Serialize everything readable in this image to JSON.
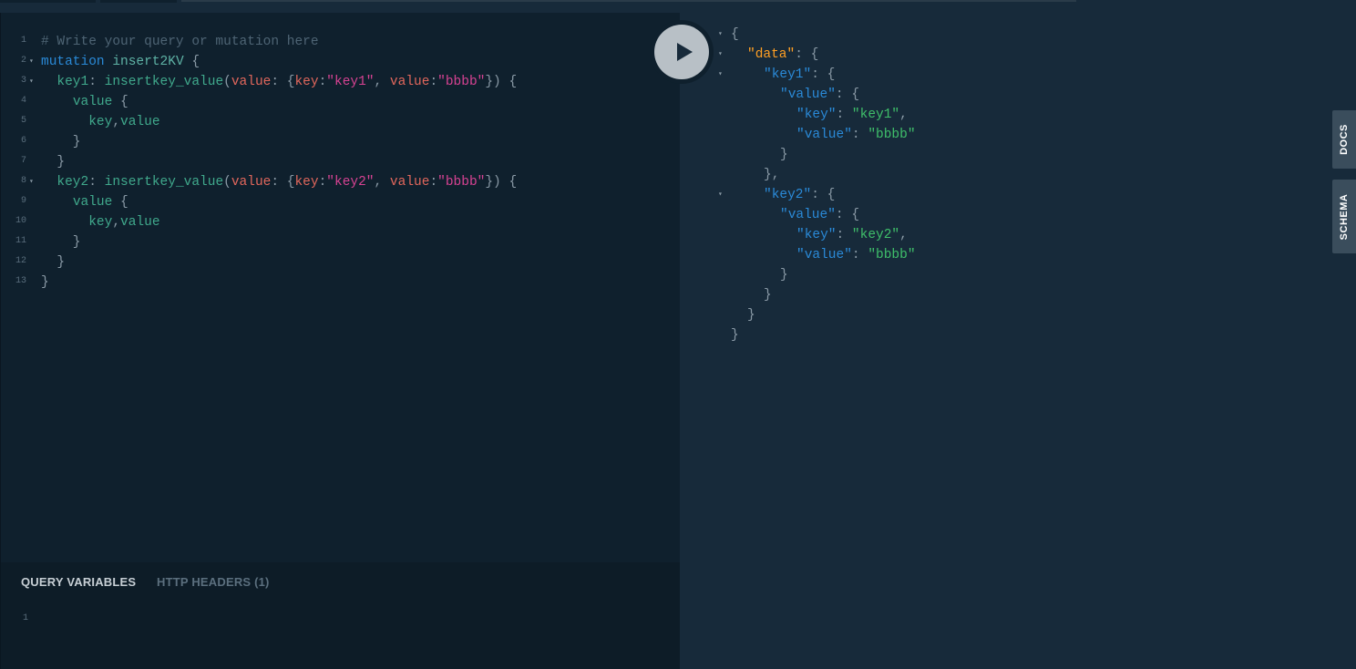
{
  "query_editor": {
    "lines": [
      {
        "n": "1",
        "tokens": [
          {
            "t": "# Write your query or mutation here",
            "c": "comment"
          }
        ]
      },
      {
        "n": "2",
        "fold": true,
        "tokens": [
          {
            "t": "mutation",
            "c": "kw"
          },
          {
            "t": " ",
            "c": "punct"
          },
          {
            "t": "insert2KV",
            "c": "def"
          },
          {
            "t": " {",
            "c": "punct"
          }
        ]
      },
      {
        "n": "3",
        "fold": true,
        "tokens": [
          {
            "t": "  ",
            "c": "punct"
          },
          {
            "t": "key1",
            "c": "field"
          },
          {
            "t": ": ",
            "c": "punct"
          },
          {
            "t": "insertkey_value",
            "c": "field"
          },
          {
            "t": "(",
            "c": "punct"
          },
          {
            "t": "value",
            "c": "arg"
          },
          {
            "t": ": {",
            "c": "punct"
          },
          {
            "t": "key",
            "c": "arg"
          },
          {
            "t": ":",
            "c": "punct"
          },
          {
            "t": "\"key1\"",
            "c": "str"
          },
          {
            "t": ", ",
            "c": "punct"
          },
          {
            "t": "value",
            "c": "arg"
          },
          {
            "t": ":",
            "c": "punct"
          },
          {
            "t": "\"bbbb\"",
            "c": "str"
          },
          {
            "t": "}) {",
            "c": "punct"
          }
        ]
      },
      {
        "n": "4",
        "tokens": [
          {
            "t": "    ",
            "c": "punct"
          },
          {
            "t": "value",
            "c": "field"
          },
          {
            "t": " {",
            "c": "punct"
          }
        ]
      },
      {
        "n": "5",
        "tokens": [
          {
            "t": "      ",
            "c": "punct"
          },
          {
            "t": "key",
            "c": "field"
          },
          {
            "t": ",",
            "c": "punct"
          },
          {
            "t": "value",
            "c": "field"
          }
        ]
      },
      {
        "n": "6",
        "tokens": [
          {
            "t": "    }",
            "c": "punct"
          }
        ]
      },
      {
        "n": "7",
        "tokens": [
          {
            "t": "  }",
            "c": "punct"
          }
        ]
      },
      {
        "n": "8",
        "fold": true,
        "tokens": [
          {
            "t": "  ",
            "c": "punct"
          },
          {
            "t": "key2",
            "c": "field"
          },
          {
            "t": ": ",
            "c": "punct"
          },
          {
            "t": "insertkey_value",
            "c": "field"
          },
          {
            "t": "(",
            "c": "punct"
          },
          {
            "t": "value",
            "c": "arg"
          },
          {
            "t": ": {",
            "c": "punct"
          },
          {
            "t": "key",
            "c": "arg"
          },
          {
            "t": ":",
            "c": "punct"
          },
          {
            "t": "\"key2\"",
            "c": "str"
          },
          {
            "t": ", ",
            "c": "punct"
          },
          {
            "t": "value",
            "c": "arg"
          },
          {
            "t": ":",
            "c": "punct"
          },
          {
            "t": "\"bbbb\"",
            "c": "str"
          },
          {
            "t": "}) {",
            "c": "punct"
          }
        ]
      },
      {
        "n": "9",
        "tokens": [
          {
            "t": "    ",
            "c": "punct"
          },
          {
            "t": "value",
            "c": "field"
          },
          {
            "t": " {",
            "c": "punct"
          }
        ]
      },
      {
        "n": "10",
        "tokens": [
          {
            "t": "      ",
            "c": "punct"
          },
          {
            "t": "key",
            "c": "field"
          },
          {
            "t": ",",
            "c": "punct"
          },
          {
            "t": "value",
            "c": "field"
          }
        ]
      },
      {
        "n": "11",
        "tokens": [
          {
            "t": "    }",
            "c": "punct"
          }
        ]
      },
      {
        "n": "12",
        "tokens": [
          {
            "t": "  }",
            "c": "punct"
          }
        ]
      },
      {
        "n": "13",
        "tokens": [
          {
            "t": "}",
            "c": "punct"
          }
        ]
      }
    ]
  },
  "variables_panel": {
    "tab_query_variables": "QUERY VARIABLES",
    "tab_http_headers": "HTTP HEADERS (1)",
    "line_number": "1"
  },
  "execute_button": {
    "icon": "play-icon"
  },
  "result_pane": {
    "lines": [
      {
        "fold": true,
        "indent": 0,
        "tokens": [
          {
            "t": "{",
            "c": "punct"
          }
        ]
      },
      {
        "fold": true,
        "indent": 1,
        "tokens": [
          {
            "t": "\"data\"",
            "c": "data"
          },
          {
            "t": ": {",
            "c": "punct"
          }
        ]
      },
      {
        "fold": true,
        "indent": 2,
        "tokens": [
          {
            "t": "\"key1\"",
            "c": "key"
          },
          {
            "t": ": {",
            "c": "punct"
          }
        ]
      },
      {
        "indent": 3,
        "tokens": [
          {
            "t": "\"value\"",
            "c": "key"
          },
          {
            "t": ": {",
            "c": "punct"
          }
        ]
      },
      {
        "indent": 4,
        "tokens": [
          {
            "t": "\"key\"",
            "c": "key"
          },
          {
            "t": ": ",
            "c": "punct"
          },
          {
            "t": "\"key1\"",
            "c": "str"
          },
          {
            "t": ",",
            "c": "punct"
          }
        ]
      },
      {
        "indent": 4,
        "tokens": [
          {
            "t": "\"value\"",
            "c": "key"
          },
          {
            "t": ": ",
            "c": "punct"
          },
          {
            "t": "\"bbbb\"",
            "c": "str"
          }
        ]
      },
      {
        "indent": 3,
        "tokens": [
          {
            "t": "}",
            "c": "punct"
          }
        ]
      },
      {
        "indent": 2,
        "tokens": [
          {
            "t": "},",
            "c": "punct"
          }
        ]
      },
      {
        "fold": true,
        "indent": 2,
        "tokens": [
          {
            "t": "\"key2\"",
            "c": "key"
          },
          {
            "t": ": {",
            "c": "punct"
          }
        ]
      },
      {
        "indent": 3,
        "tokens": [
          {
            "t": "\"value\"",
            "c": "key"
          },
          {
            "t": ": {",
            "c": "punct"
          }
        ]
      },
      {
        "indent": 4,
        "tokens": [
          {
            "t": "\"key\"",
            "c": "key"
          },
          {
            "t": ": ",
            "c": "punct"
          },
          {
            "t": "\"key2\"",
            "c": "str"
          },
          {
            "t": ",",
            "c": "punct"
          }
        ]
      },
      {
        "indent": 4,
        "tokens": [
          {
            "t": "\"value\"",
            "c": "key"
          },
          {
            "t": ": ",
            "c": "punct"
          },
          {
            "t": "\"bbbb\"",
            "c": "str"
          }
        ]
      },
      {
        "indent": 3,
        "tokens": [
          {
            "t": "}",
            "c": "punct"
          }
        ]
      },
      {
        "indent": 2,
        "tokens": [
          {
            "t": "}",
            "c": "punct"
          }
        ]
      },
      {
        "indent": 1,
        "tokens": [
          {
            "t": "}",
            "c": "punct"
          }
        ]
      },
      {
        "indent": 0,
        "tokens": [
          {
            "t": "}",
            "c": "punct"
          }
        ]
      }
    ]
  },
  "side_tabs": {
    "docs": "DOCS",
    "schema": "SCHEMA"
  },
  "colors": {
    "background": "#172a3a",
    "editor_bg": "#0f202d",
    "keyword": "#2a8ad8",
    "field": "#40a98c",
    "argument": "#e2675c",
    "string": "#d64292",
    "json_data_key": "#ff9f23",
    "json_string": "#3fbf6a"
  }
}
